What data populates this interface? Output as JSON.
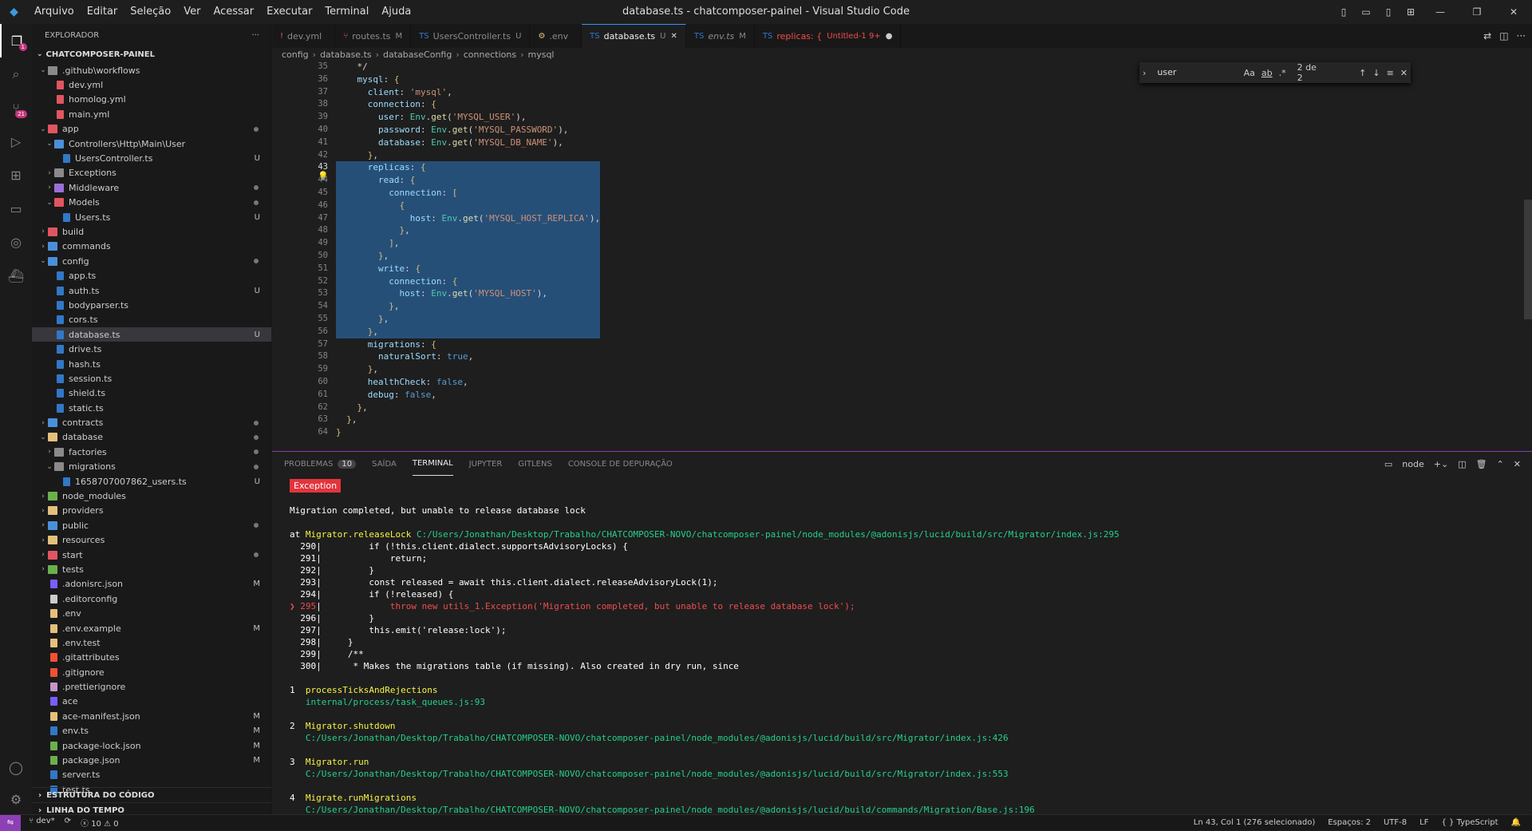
{
  "window": {
    "title": "database.ts - chatcomposer-painel - Visual Studio Code",
    "menu": [
      "Arquivo",
      "Editar",
      "Seleção",
      "Ver",
      "Acessar",
      "Executar",
      "Terminal",
      "Ajuda"
    ]
  },
  "activity": {
    "source_control_badge": "21",
    "explorer_badge": "1"
  },
  "sidebar": {
    "title": "EXPLORADOR",
    "project": "CHATCOMPOSER-PAINEL",
    "items": [
      {
        "label": ".github\\workflows",
        "depth": 1,
        "type": "folder",
        "open": true,
        "icon": "folder"
      },
      {
        "label": "dev.yml",
        "depth": 2,
        "type": "file",
        "icon": "yml"
      },
      {
        "label": "homolog.yml",
        "depth": 2,
        "type": "file",
        "icon": "yml"
      },
      {
        "label": "main.yml",
        "depth": 2,
        "type": "file",
        "icon": "yml"
      },
      {
        "label": "app",
        "depth": 1,
        "type": "folder",
        "open": true,
        "icon": "app",
        "dot": true
      },
      {
        "label": "Controllers\\Http\\Main\\User",
        "depth": 2,
        "type": "folder",
        "open": true,
        "icon": "folder-blue"
      },
      {
        "label": "UsersController.ts",
        "depth": 3,
        "type": "file",
        "icon": "ts",
        "badge": "U"
      },
      {
        "label": "Exceptions",
        "depth": 2,
        "type": "folder",
        "open": false,
        "icon": "folder"
      },
      {
        "label": "Middleware",
        "depth": 2,
        "type": "folder",
        "open": false,
        "icon": "folder-purple",
        "dot": true
      },
      {
        "label": "Models",
        "depth": 2,
        "type": "folder",
        "open": true,
        "icon": "folder-red",
        "dot": true
      },
      {
        "label": "Users.ts",
        "depth": 3,
        "type": "file",
        "icon": "ts",
        "badge": "U"
      },
      {
        "label": "build",
        "depth": 1,
        "type": "folder",
        "open": false,
        "icon": "folder-red"
      },
      {
        "label": "commands",
        "depth": 1,
        "type": "folder",
        "open": false,
        "icon": "folder-blue"
      },
      {
        "label": "config",
        "depth": 1,
        "type": "folder",
        "open": true,
        "icon": "folder-blue",
        "dot": true
      },
      {
        "label": "app.ts",
        "depth": 2,
        "type": "file",
        "icon": "ts"
      },
      {
        "label": "auth.ts",
        "depth": 2,
        "type": "file",
        "icon": "ts",
        "badge": "U"
      },
      {
        "label": "bodyparser.ts",
        "depth": 2,
        "type": "file",
        "icon": "ts"
      },
      {
        "label": "cors.ts",
        "depth": 2,
        "type": "file",
        "icon": "ts"
      },
      {
        "label": "database.ts",
        "depth": 2,
        "type": "file",
        "icon": "ts",
        "badge": "U",
        "selected": true
      },
      {
        "label": "drive.ts",
        "depth": 2,
        "type": "file",
        "icon": "ts"
      },
      {
        "label": "hash.ts",
        "depth": 2,
        "type": "file",
        "icon": "ts"
      },
      {
        "label": "session.ts",
        "depth": 2,
        "type": "file",
        "icon": "ts"
      },
      {
        "label": "shield.ts",
        "depth": 2,
        "type": "file",
        "icon": "ts"
      },
      {
        "label": "static.ts",
        "depth": 2,
        "type": "file",
        "icon": "ts"
      },
      {
        "label": "contracts",
        "depth": 1,
        "type": "folder",
        "open": false,
        "icon": "folder-blue",
        "dot": true
      },
      {
        "label": "database",
        "depth": 1,
        "type": "folder",
        "open": true,
        "icon": "folder-yellow",
        "dot": true
      },
      {
        "label": "factories",
        "depth": 2,
        "type": "folder",
        "open": false,
        "icon": "folder",
        "dot": true
      },
      {
        "label": "migrations",
        "depth": 2,
        "type": "folder",
        "open": true,
        "icon": "folder",
        "dot": true
      },
      {
        "label": "1658707007862_users.ts",
        "depth": 3,
        "type": "file",
        "icon": "ts",
        "badge": "U"
      },
      {
        "label": "node_modules",
        "depth": 1,
        "type": "folder",
        "open": false,
        "icon": "folder-green"
      },
      {
        "label": "providers",
        "depth": 1,
        "type": "folder",
        "open": false,
        "icon": "folder-yellow"
      },
      {
        "label": "public",
        "depth": 1,
        "type": "folder",
        "open": false,
        "icon": "folder-blue",
        "dot": true
      },
      {
        "label": "resources",
        "depth": 1,
        "type": "folder",
        "open": false,
        "icon": "folder-yellow"
      },
      {
        "label": "start",
        "depth": 1,
        "type": "folder",
        "open": false,
        "icon": "folder-red",
        "dot": true
      },
      {
        "label": "tests",
        "depth": 1,
        "type": "folder",
        "open": false,
        "icon": "folder-green"
      },
      {
        "label": ".adonisrc.json",
        "depth": 1,
        "type": "file",
        "icon": "adonis",
        "badge": "M"
      },
      {
        "label": ".editorconfig",
        "depth": 1,
        "type": "file",
        "icon": "config"
      },
      {
        "label": ".env",
        "depth": 1,
        "type": "file",
        "icon": "env"
      },
      {
        "label": ".env.example",
        "depth": 1,
        "type": "file",
        "icon": "env",
        "badge": "M"
      },
      {
        "label": ".env.test",
        "depth": 1,
        "type": "file",
        "icon": "env"
      },
      {
        "label": ".gitattributes",
        "depth": 1,
        "type": "file",
        "icon": "git"
      },
      {
        "label": ".gitignore",
        "depth": 1,
        "type": "file",
        "icon": "git"
      },
      {
        "label": ".prettierignore",
        "depth": 1,
        "type": "file",
        "icon": "prettier"
      },
      {
        "label": "ace",
        "depth": 1,
        "type": "file",
        "icon": "adonis"
      },
      {
        "label": "ace-manifest.json",
        "depth": 1,
        "type": "file",
        "icon": "json",
        "badge": "M"
      },
      {
        "label": "env.ts",
        "depth": 1,
        "type": "file",
        "icon": "ts",
        "badge": "M"
      },
      {
        "label": "package-lock.json",
        "depth": 1,
        "type": "file",
        "icon": "npm",
        "badge": "M"
      },
      {
        "label": "package.json",
        "depth": 1,
        "type": "file",
        "icon": "npm",
        "badge": "M"
      },
      {
        "label": "server.ts",
        "depth": 1,
        "type": "file",
        "icon": "ts"
      },
      {
        "label": "test.ts",
        "depth": 1,
        "type": "file",
        "icon": "ts"
      }
    ],
    "sections": [
      "ESTRUTURA DO CÓDIGO",
      "LINHA DO TEMPO"
    ]
  },
  "tabs": [
    {
      "label": "dev.yml",
      "status": "",
      "icon": "yml"
    },
    {
      "label": "routes.ts",
      "status": "M",
      "icon": "routes"
    },
    {
      "label": "UsersController.ts",
      "status": "U",
      "icon": "ts"
    },
    {
      "label": ".env",
      "status": "",
      "icon": "env"
    },
    {
      "label": "database.ts",
      "status": "U",
      "icon": "ts",
      "active": true
    },
    {
      "label": "env.ts",
      "status": "M",
      "icon": "ts",
      "italic": true
    },
    {
      "label": "replicas: {",
      "status": "Untitled-1 9+",
      "icon": "ts",
      "dirty": true,
      "red": true
    }
  ],
  "breadcrumb": [
    "config",
    "database.ts",
    "databaseConfig",
    "connections",
    "mysql"
  ],
  "find": {
    "query": "user",
    "count": "2 de 2",
    "opts": [
      "Aa",
      "ab",
      ".*"
    ]
  },
  "editor": {
    "lines": [
      {
        "n": "35",
        "t": "    */"
      },
      {
        "n": "36",
        "t": "    mysql: {"
      },
      {
        "n": "37",
        "t": "      client: 'mysql',"
      },
      {
        "n": "38",
        "t": "      connection: {"
      },
      {
        "n": "39",
        "t": "        user: Env.get('MYSQL_USER'),"
      },
      {
        "n": "40",
        "t": "        password: Env.get('MYSQL_PASSWORD'),"
      },
      {
        "n": "41",
        "t": "        database: Env.get('MYSQL_DB_NAME'),"
      },
      {
        "n": "42",
        "t": "      },"
      },
      {
        "n": "43",
        "t": "      replicas: {",
        "sel": true
      },
      {
        "n": "44",
        "t": "        read: {",
        "sel": true
      },
      {
        "n": "45",
        "t": "          connection: [",
        "sel": true
      },
      {
        "n": "46",
        "t": "            {",
        "sel": true
      },
      {
        "n": "47",
        "t": "              host: Env.get('MYSQL_HOST_REPLICA'),",
        "sel": true
      },
      {
        "n": "48",
        "t": "            },",
        "sel": true
      },
      {
        "n": "49",
        "t": "          ],",
        "sel": true
      },
      {
        "n": "50",
        "t": "        },",
        "sel": true
      },
      {
        "n": "51",
        "t": "        write: {",
        "sel": true
      },
      {
        "n": "52",
        "t": "          connection: {",
        "sel": true
      },
      {
        "n": "53",
        "t": "            host: Env.get('MYSQL_HOST'),",
        "sel": true
      },
      {
        "n": "54",
        "t": "          },",
        "sel": true
      },
      {
        "n": "55",
        "t": "        },",
        "sel": true
      },
      {
        "n": "56",
        "t": "      },",
        "sel": true
      },
      {
        "n": "57",
        "t": "      migrations: {"
      },
      {
        "n": "58",
        "t": "        naturalSort: true,"
      },
      {
        "n": "59",
        "t": "      },"
      },
      {
        "n": "60",
        "t": "      healthCheck: false,"
      },
      {
        "n": "61",
        "t": "      debug: false,"
      },
      {
        "n": "62",
        "t": "    },"
      },
      {
        "n": "63",
        "t": "  },"
      },
      {
        "n": "64",
        "t": "}"
      }
    ]
  },
  "panel": {
    "tabs": [
      "PROBLEMAS",
      "SAÍDA",
      "TERMINAL",
      "JUPYTER",
      "GITLENS",
      "CONSOLE DE DEPURAÇÃO"
    ],
    "problems_count": "10",
    "shell": "node",
    "exception_label": "Exception",
    "message": "Migration completed, but unable to release database lock",
    "at_prefix": "at ",
    "at_fn": "Migrator.releaseLock",
    "at_path": "C:/Users/Jonathan/Desktop/Trabalho/CHATCOMPOSER-NOVO/chatcomposer-painel/node_modules/@adonisjs/lucid/build/src/Migrator/index.js:295",
    "source": [
      {
        "n": "290",
        "t": "        if (!this.client.dialect.supportsAdvisoryLocks) {"
      },
      {
        "n": "291",
        "t": "            return;"
      },
      {
        "n": "292",
        "t": "        }"
      },
      {
        "n": "293",
        "t": "        const released = await this.client.dialect.releaseAdvisoryLock(1);"
      },
      {
        "n": "294",
        "t": "        if (!released) {"
      },
      {
        "n": "295",
        "t": "            throw new utils_1.Exception('Migration completed, but unable to release database lock');",
        "err": true
      },
      {
        "n": "296",
        "t": "        }"
      },
      {
        "n": "297",
        "t": "        this.emit('release:lock');"
      },
      {
        "n": "298",
        "t": "    }"
      },
      {
        "n": "299",
        "t": "    /**"
      },
      {
        "n": "300",
        "t": "     * Makes the migrations table (if missing). Also created in dry run, since"
      }
    ],
    "stack": [
      {
        "n": "1",
        "fn": "processTicksAndRejections",
        "path": "internal/process/task_queues.js:93"
      },
      {
        "n": "2",
        "fn": "Migrator.shutdown",
        "path": "C:/Users/Jonathan/Desktop/Trabalho/CHATCOMPOSER-NOVO/chatcomposer-painel/node_modules/@adonisjs/lucid/build/src/Migrator/index.js:426"
      },
      {
        "n": "3",
        "fn": "Migrator.run",
        "path": "C:/Users/Jonathan/Desktop/Trabalho/CHATCOMPOSER-NOVO/chatcomposer-painel/node_modules/@adonisjs/lucid/build/src/Migrator/index.js:553"
      },
      {
        "n": "4",
        "fn": "Migrate.runMigrations",
        "path": "C:/Users/Jonathan/Desktop/Trabalho/CHATCOMPOSER-NOVO/chatcomposer-painel/node_modules/@adonisjs/lucid/build/commands/Migration/Base.js:196"
      }
    ]
  },
  "status": {
    "branch": "dev*",
    "errors": "10",
    "warnings": "0",
    "position": "Ln 43, Col 1 (276 selecionado)",
    "spaces": "Espaços: 2",
    "encoding": "UTF-8",
    "eol": "LF",
    "language": "TypeScript"
  },
  "colors": {
    "accent": "#3794ff",
    "selection": "#264f78",
    "panel_border": "#8a3aa6",
    "remote": "#8d3fb6"
  }
}
